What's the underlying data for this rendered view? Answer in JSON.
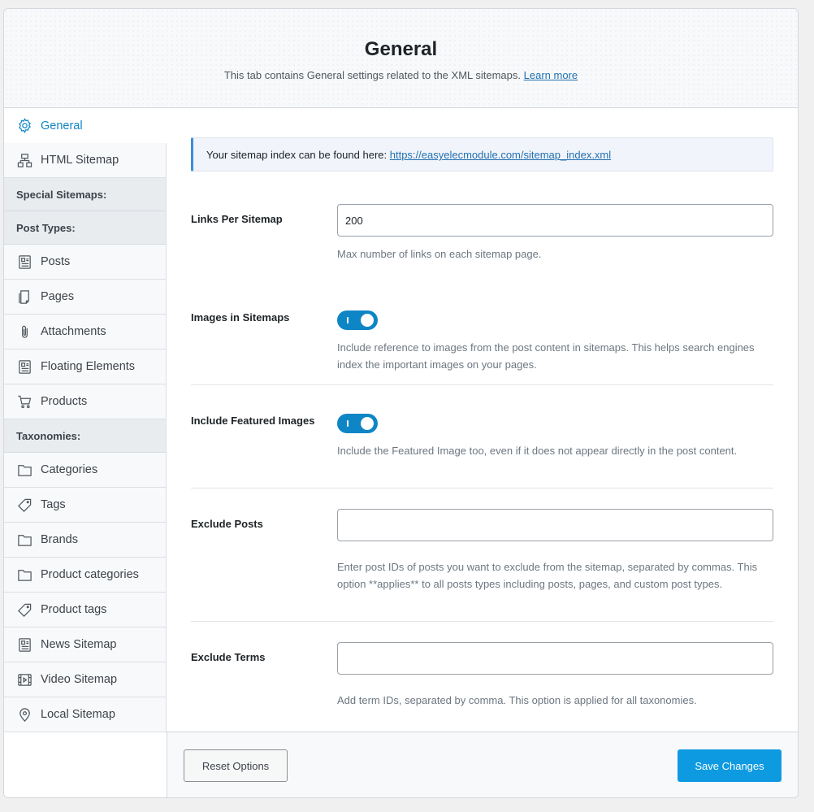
{
  "header": {
    "title": "General",
    "subtitle": "This tab contains General settings related to the XML sitemaps.",
    "learn_more": "Learn more"
  },
  "sidebar": {
    "items": [
      {
        "label": "General",
        "icon": "gear-icon"
      },
      {
        "label": "HTML Sitemap",
        "icon": "sitemap-icon"
      },
      {
        "heading": "Special Sitemaps:"
      },
      {
        "heading": "Post Types:"
      },
      {
        "label": "Posts",
        "icon": "document-icon"
      },
      {
        "label": "Pages",
        "icon": "page-icon"
      },
      {
        "label": "Attachments",
        "icon": "paperclip-icon"
      },
      {
        "label": "Floating Elements",
        "icon": "document-icon"
      },
      {
        "label": "Products",
        "icon": "cart-icon"
      },
      {
        "heading": "Taxonomies:"
      },
      {
        "label": "Categories",
        "icon": "folder-icon"
      },
      {
        "label": "Tags",
        "icon": "tag-icon"
      },
      {
        "label": "Brands",
        "icon": "folder-icon"
      },
      {
        "label": "Product categories",
        "icon": "folder-icon"
      },
      {
        "label": "Product tags",
        "icon": "tag-icon"
      },
      {
        "label": "News Sitemap",
        "icon": "news-icon"
      },
      {
        "label": "Video Sitemap",
        "icon": "video-icon"
      },
      {
        "label": "Local Sitemap",
        "icon": "map-pin-icon"
      }
    ]
  },
  "notice": {
    "text": "Your sitemap index can be found here:",
    "link": "https://easyelecmodule.com/sitemap_index.xml"
  },
  "settings": {
    "links_per_sitemap": {
      "label": "Links Per Sitemap",
      "value": "200",
      "desc": "Max number of links on each sitemap page."
    },
    "images_in_sitemaps": {
      "label": "Images in Sitemaps",
      "enabled": true,
      "desc": "Include reference to images from the post content in sitemaps. This helps search engines index the important images on your pages."
    },
    "include_featured_images": {
      "label": "Include Featured Images",
      "enabled": true,
      "desc": "Include the Featured Image too, even if it does not appear directly in the post content."
    },
    "exclude_posts": {
      "label": "Exclude Posts",
      "value": "",
      "desc": "Enter post IDs of posts you want to exclude from the sitemap, separated by commas. This option **applies** to all posts types including posts, pages, and custom post types."
    },
    "exclude_terms": {
      "label": "Exclude Terms",
      "value": "",
      "desc": "Add term IDs, separated by comma. This option is applied for all taxonomies."
    }
  },
  "footer": {
    "reset_label": "Reset Options",
    "save_label": "Save Changes"
  },
  "colors": {
    "accent": "#0e86c6",
    "save_button": "#0e9ae0",
    "notice_border": "#3a8fd6"
  }
}
